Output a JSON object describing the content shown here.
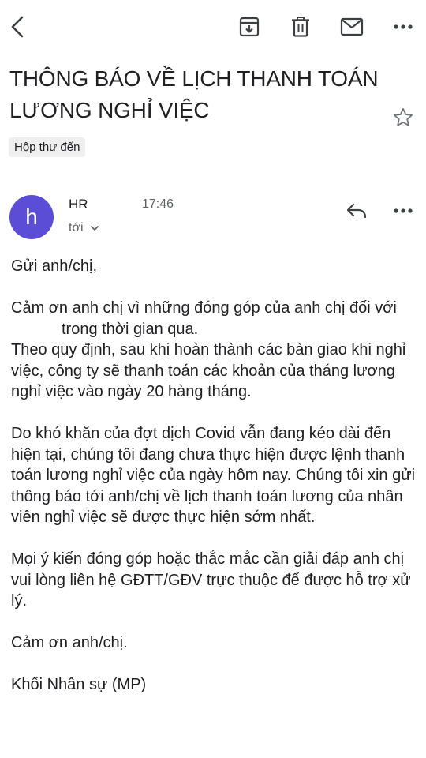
{
  "toolbar": {
    "back": "chevron-left-icon",
    "archive": "archive-icon",
    "delete": "trash-icon",
    "mark_unread": "mail-icon",
    "more": "more-horizontal-icon"
  },
  "email": {
    "subject": "THÔNG BÁO VỀ LỊCH THANH TOÁN LƯƠNG NGHỈ VIỆC",
    "label": "Hộp thư đến",
    "avatar_letter": "h",
    "avatar_color": "#5b4dd6",
    "sender": "HR",
    "time": "17:46",
    "recipient": "tới",
    "body": {
      "greeting": "Gửi anh/chị,",
      "p1_a": "Cảm ơn anh chị vì những đóng góp của anh chị đối với",
      "p1_b": "trong thời gian qua.",
      "p2": "Theo quy định, sau khi hoàn thành các bàn giao khi nghỉ việc, công ty sẽ thanh toán các khoản của tháng lương nghỉ việc vào ngày 20 hàng tháng.",
      "p3": "Do khó khăn của đợt dịch Covid vẫn đang kéo dài đến hiện tại, chúng tôi đang chưa thực hiện được lệnh thanh toán lương nghỉ việc của ngày hôm nay. Chúng tôi xin gửi thông báo tới anh/chị về lịch thanh toán lương của nhân viên nghỉ việc sẽ được thực hiện sớm nhất.",
      "p4": "Mọi ý kiến đóng góp hoặc thắc mắc cần giải đáp anh chị vui lòng liên hệ GĐTT/GĐV trực thuộc để được hỗ trợ xử lý.",
      "thanks": "Cảm ơn anh/chị.",
      "signature": "Khối Nhân sự (MP)"
    }
  }
}
